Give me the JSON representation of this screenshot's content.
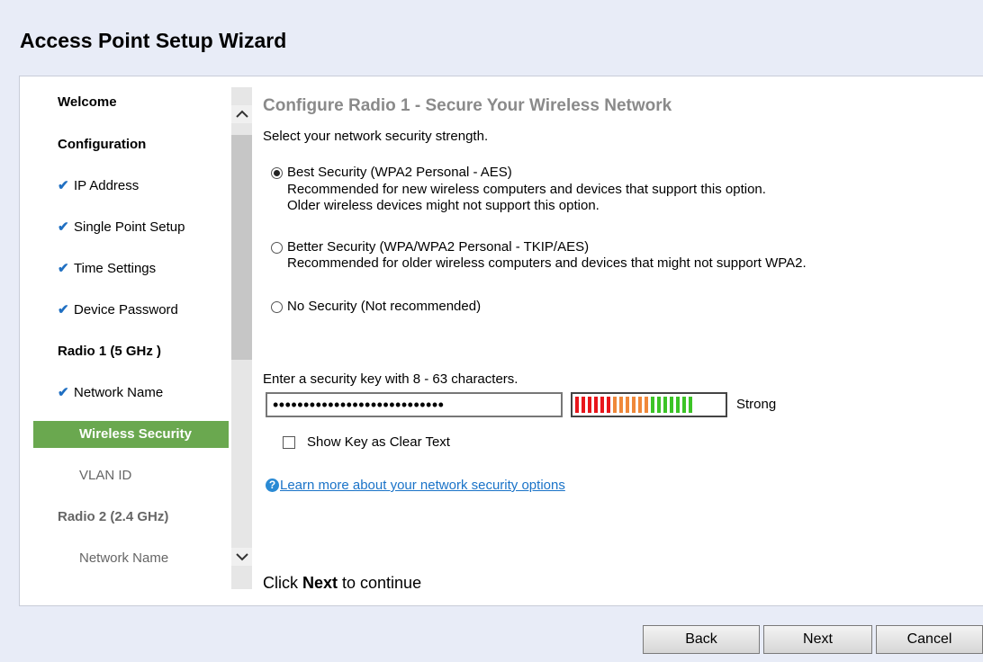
{
  "window": {
    "title": "Access Point Setup Wizard"
  },
  "sidebar": {
    "items": [
      {
        "label": "Welcome"
      },
      {
        "label": "Configuration"
      },
      {
        "label": "IP Address",
        "check": "✔"
      },
      {
        "label": "Single Point Setup",
        "check": "✔"
      },
      {
        "label": "Time Settings",
        "check": "✔"
      },
      {
        "label": "Device Password",
        "check": "✔"
      },
      {
        "label": "Radio 1 (5 GHz )"
      },
      {
        "label": "Network Name",
        "check": "✔"
      },
      {
        "label": "Wireless Security"
      },
      {
        "label": "VLAN ID"
      },
      {
        "label": "Radio 2 (2.4 GHz)"
      },
      {
        "label": "Network Name"
      }
    ],
    "scroll_up_icon": "chevron-up-icon",
    "scroll_down_icon": "chevron-down-icon",
    "check_icon": "checkmark-icon"
  },
  "main": {
    "title": "Configure Radio 1 - Secure Your Wireless Network",
    "prompt": "Select your network security strength.",
    "options": [
      {
        "label": "Best Security (WPA2 Personal - AES)",
        "desc1": "Recommended for new wireless computers and devices that support this option.",
        "desc2": "Older wireless devices might not support this option.",
        "selected": true
      },
      {
        "label": "Better Security (WPA/WPA2 Personal - TKIP/AES)",
        "desc1": "Recommended for older wireless computers and devices that might not support WPA2.",
        "selected": false
      },
      {
        "label": "No Security (Not recommended)",
        "selected": false
      }
    ],
    "key_prompt": "Enter a security key with 8 - 63 characters.",
    "key_value": "••••••••••••••••••••••••••••",
    "strength_label": "Strong",
    "strength_colors": [
      "#e8161b",
      "#e8161b",
      "#e8161b",
      "#e8161b",
      "#e8161b",
      "#e8161b",
      "#f0883a",
      "#f0883a",
      "#f0883a",
      "#f0883a",
      "#f0883a",
      "#f0883a",
      "#3cc426",
      "#3cc426",
      "#3cc426",
      "#3cc426",
      "#3cc426",
      "#3cc426",
      "#3cc426"
    ],
    "show_key_label": "Show Key as Clear Text",
    "show_key_checked": false,
    "help_icon": "question-circle-icon",
    "help_link": "Learn more about your network security options",
    "continue_prefix": "Click ",
    "continue_bold": "Next",
    "continue_suffix": " to continue"
  },
  "footer": {
    "back": "Back",
    "next": "Next",
    "cancel": "Cancel"
  },
  "colors": {
    "active_nav": "#6aa84f",
    "check": "#1f6fc2",
    "link": "#1a73c8",
    "background": "#e8ecf7"
  }
}
